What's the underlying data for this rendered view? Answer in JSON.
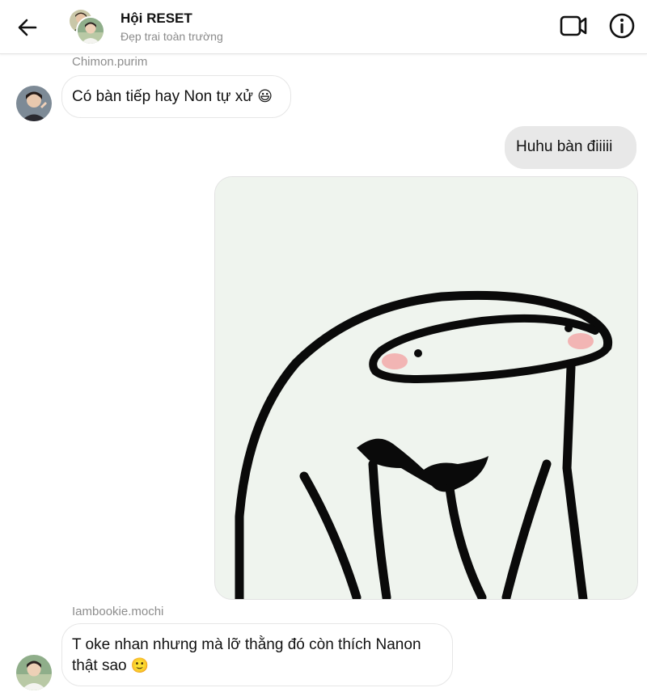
{
  "header": {
    "title": "Hội RESET",
    "subtitle": "Đẹp trai toàn trường",
    "back_icon": "back-arrow-icon",
    "video_icon": "video-call-icon",
    "info_icon": "info-icon"
  },
  "messages": [
    {
      "sender": "Chimon.purim",
      "text": "Có bàn tiếp hay Non tự xử",
      "emoji": "😃"
    },
    {
      "text": "Huhu bàn điiiii"
    },
    {
      "sticker": "flork-sticker"
    },
    {
      "sender": "Iambookie.mochi",
      "text_line1": "T oke nhan nhưng mà lỡ thằng đó còn thích Nanon",
      "text_line2": "thật sao",
      "emoji": "🙂"
    }
  ],
  "colors": {
    "outgoing_bubble": "#e8e8e8",
    "incoming_bubble": "#ffffff",
    "sticker_background": "#eff4ee"
  }
}
